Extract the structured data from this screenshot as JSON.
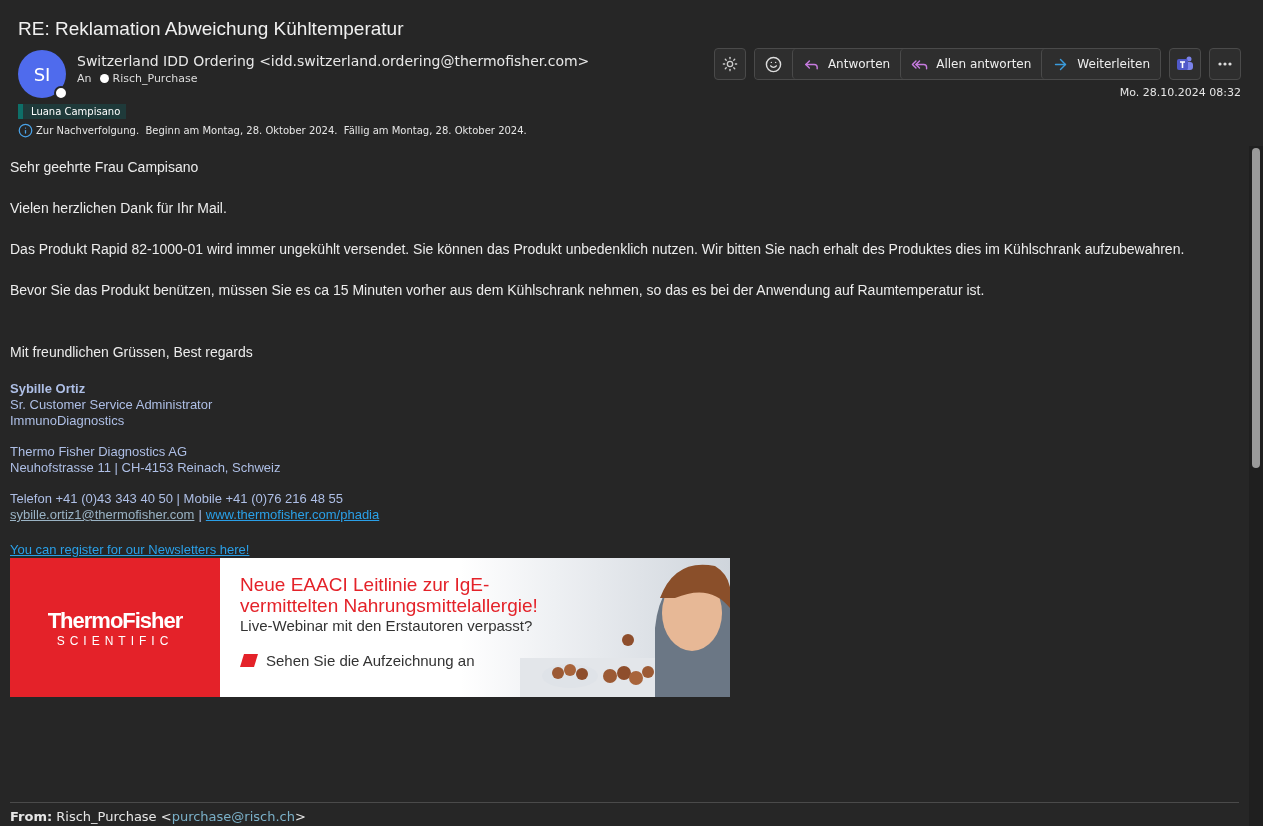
{
  "message": {
    "subject": "RE: Reklamation Abweichung Kühltemperatur",
    "sender": {
      "initials": "SI",
      "line": "Switzerland IDD Ordering <idd.switzerland.ordering@thermofisher.com>"
    },
    "to_label": "An",
    "recipient": "Risch_Purchase",
    "category": {
      "label": "Luana Campisano",
      "color": "#0e6f68"
    },
    "followup": "Zur Nachverfolgung.  Beginn am Montag, 28. Oktober 2024.  Fällig am Montag, 28. Oktober 2024.",
    "date": "Mo. 28.10.2024 08:32"
  },
  "toolbar": [
    {
      "kind": "theme"
    },
    {
      "kind": "emoji"
    },
    {
      "kind": "reply",
      "label": "Antworten"
    },
    {
      "kind": "reply_all",
      "label": "Allen antworten"
    },
    {
      "kind": "forward",
      "label": "Weiterleiten"
    },
    {
      "kind": "teams"
    },
    {
      "kind": "more"
    }
  ],
  "body": {
    "paragraphs": [
      "Sehr geehrte Frau Campisano",
      "Vielen herzlichen Dank für Ihr Mail.",
      "Das Produkt Rapid 82-1000-01 wird immer ungekühlt versendet. Sie können das Produkt unbedenklich nutzen. Wir bitten Sie nach erhalt des Produktes dies im Kühlschrank aufzubewahren.",
      "Bevor Sie das Produkt benützen, müssen Sie es ca 15 Minuten vorher aus dem Kühlschrank nehmen, so das es bei der Anwendung auf Raumtemperatur ist."
    ],
    "closing": "Mit freundlichen Grüssen, Best regards",
    "signature": {
      "name": "Sybille Ortiz",
      "title": "Sr. Customer Service Administrator",
      "department": "ImmunoDiagnostics",
      "company": "Thermo Fisher Diagnostics AG",
      "address": "Neuhofstrasse 11 | CH-4153 Reinach, Schweiz",
      "phone": "Telefon +41 (0)43 343 40 50 | Mobile +41 (0)76 216 48 55",
      "email": "sybille.ortiz1@thermofisher.com",
      "separator": "|",
      "website": "www.thermofisher.com/phadia",
      "newsletter": "You can register for our Newsletters here!"
    }
  },
  "banner": {
    "logo_main": "ThermoFisher",
    "logo_sub": "SCIENTIFIC",
    "headline": [
      "Neue EAACI Leitlinie zur IgE-",
      "vermittelten Nahrungsmittelallergie!"
    ],
    "subline": "Live-Webinar mit den Erstautoren verpasst?",
    "cta": "Sehen Sie die Aufzeichnung an"
  },
  "quoted": {
    "from_label": "From:",
    "from_name": "Risch_Purchase <",
    "from_email": "purchase@risch.ch",
    "from_tail": ">"
  }
}
